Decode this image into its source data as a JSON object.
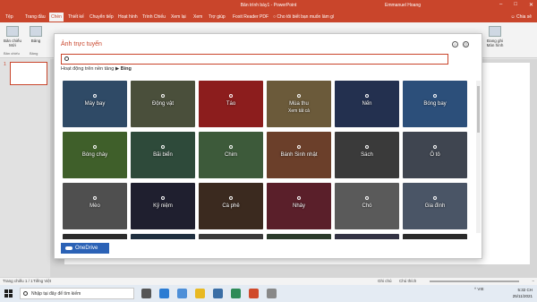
{
  "window": {
    "title": "Bản trình bày1 - PowerPoint",
    "user": "Emmanuel Hoang",
    "controls": [
      "–",
      "□",
      "✕"
    ]
  },
  "ribbon_tabs": [
    {
      "label": "Tệp",
      "active": false
    },
    {
      "label": "Trang đầu",
      "active": false
    },
    {
      "label": "Chèn",
      "active": true
    },
    {
      "label": "Thiết kế",
      "active": false
    },
    {
      "label": "Chuyển tiếp",
      "active": false
    },
    {
      "label": "Hoạt hình",
      "active": false
    },
    {
      "label": "Trình Chiếu",
      "active": false
    },
    {
      "label": "Xem lại",
      "active": false
    },
    {
      "label": "Xem",
      "active": false
    },
    {
      "label": "Trợ giúp",
      "active": false
    },
    {
      "label": "Foxit Reader PDF",
      "active": false
    }
  ],
  "tell_me": "Cho tôi biết bạn muốn làm gì",
  "share": "Chia sẻ",
  "ribbon_groups": {
    "new_slide": "Bản chiếu Mới",
    "slides_group": "Bản chiếu",
    "table": "Bảng",
    "table_group": "Bảng",
    "audio": "Đang ghi Màn hình"
  },
  "slide_pane": {
    "slide_number": "1"
  },
  "statusbar": {
    "slide_info": "Trang chiếu 1 / 1",
    "language": "Tiếng Việt",
    "notes": "Ghi chú",
    "comments": "Chú thích",
    "zoom": "−"
  },
  "dialog": {
    "title": "Ảnh trực tuyến",
    "search_placeholder": "",
    "subtitle": "Hoạt động trên nền tảng",
    "provider": "Bing",
    "onedrive_label": "OneDrive",
    "tiles": [
      {
        "label": "Máy bay",
        "sub": "",
        "color": "#2f4a66"
      },
      {
        "label": "Động vật",
        "sub": "",
        "color": "#4a4f3b"
      },
      {
        "label": "Táo",
        "sub": "",
        "color": "#8c1d1d"
      },
      {
        "label": "Mùa thu",
        "sub": "Xem tất cả",
        "color": "#6b5a3a"
      },
      {
        "label": "Nến",
        "sub": "",
        "color": "#23304f"
      },
      {
        "label": "Bóng bay",
        "sub": "",
        "color": "#2c4f7a"
      },
      {
        "label": "Bóng chày",
        "sub": "",
        "color": "#3f5f2a"
      },
      {
        "label": "Bãi biển",
        "sub": "",
        "color": "#2e4a3a"
      },
      {
        "label": "Chim",
        "sub": "",
        "color": "#3d5a3a"
      },
      {
        "label": "Bánh Sinh nhật",
        "sub": "",
        "color": "#6b3f2a"
      },
      {
        "label": "Sách",
        "sub": "",
        "color": "#3a3a3a"
      },
      {
        "label": "Ô tô",
        "sub": "",
        "color": "#3f4550"
      },
      {
        "label": "Mèo",
        "sub": "",
        "color": "#4f4f4f"
      },
      {
        "label": "Kỷ niệm",
        "sub": "",
        "color": "#1f1f2f"
      },
      {
        "label": "Cà phê",
        "sub": "",
        "color": "#3b2a1f"
      },
      {
        "label": "Nhảy",
        "sub": "",
        "color": "#5a1f2a"
      },
      {
        "label": "Chó",
        "sub": "",
        "color": "#5a5a5a"
      },
      {
        "label": "Gia đình",
        "sub": "",
        "color": "#4a5566"
      },
      {
        "label": "",
        "sub": "",
        "color": "#2b2b2b"
      },
      {
        "label": "",
        "sub": "",
        "color": "#1f2f3f"
      },
      {
        "label": "",
        "sub": "",
        "color": "#3a3a3a"
      },
      {
        "label": "",
        "sub": "",
        "color": "#2b3b2b"
      },
      {
        "label": "",
        "sub": "",
        "color": "#333344"
      },
      {
        "label": "",
        "sub": "",
        "color": "#2a2a2a"
      }
    ]
  },
  "taskbar": {
    "search_text": "Nhập tại đây để tìm kiếm",
    "tray": "^  VIE",
    "time": "5:32 CH",
    "date": "25/11/2021"
  },
  "colors": {
    "accent": "#c9452b",
    "onedrive": "#2b62b6"
  }
}
